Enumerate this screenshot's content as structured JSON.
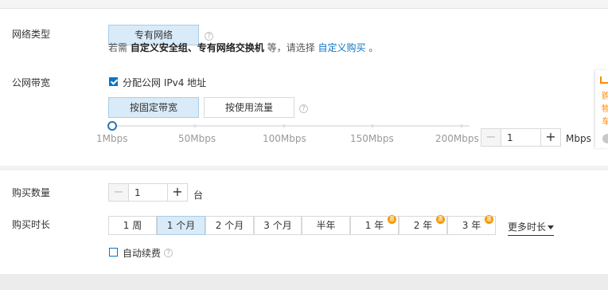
{
  "network": {
    "label": "网络类型",
    "type_button": "专有网络",
    "hint_prefix": "若需",
    "hint_bold": "自定义安全组、专有网络交换机",
    "hint_middle": "等，请选择",
    "hint_link": "自定义购买",
    "hint_suffix": "。"
  },
  "bandwidth": {
    "label": "公网带宽",
    "assign_ipv4_label": "分配公网 IPv4 地址",
    "assign_ipv4_checked": true,
    "billing_fixed": "按固定带宽",
    "billing_traffic": "按使用流量",
    "slider_ticks": [
      "1Mbps",
      "50Mbps",
      "100Mbps",
      "150Mbps",
      "200Mbps"
    ],
    "value": "1",
    "unit": "Mbps"
  },
  "purchase": {
    "quantity_label": "购买数量",
    "quantity_value": "1",
    "quantity_unit": "台",
    "duration_label": "购买时长",
    "durations": [
      {
        "label": "1 周",
        "selected": false,
        "badge": false
      },
      {
        "label": "1 个月",
        "selected": true,
        "badge": false
      },
      {
        "label": "2 个月",
        "selected": false,
        "badge": false
      },
      {
        "label": "3 个月",
        "selected": false,
        "badge": false
      },
      {
        "label": "半年",
        "selected": false,
        "badge": false
      },
      {
        "label": "1 年",
        "selected": false,
        "badge": true
      },
      {
        "label": "2 年",
        "selected": false,
        "badge": true
      },
      {
        "label": "3 年",
        "selected": false,
        "badge": true
      }
    ],
    "more_durations": "更多时长",
    "auto_renew_label": "自动续费",
    "auto_renew_checked": false
  },
  "side_tab": {
    "chars": [
      "购",
      "物",
      "车"
    ]
  },
  "colors": {
    "accent": "#0b75c4",
    "selected_bg": "#d9ebf8",
    "badge": "#f39800"
  },
  "icons": {
    "help": "question-circle-icon",
    "minus": "minus-icon",
    "plus": "plus-icon",
    "cart": "cart-icon",
    "caret": "caret-down-icon"
  }
}
